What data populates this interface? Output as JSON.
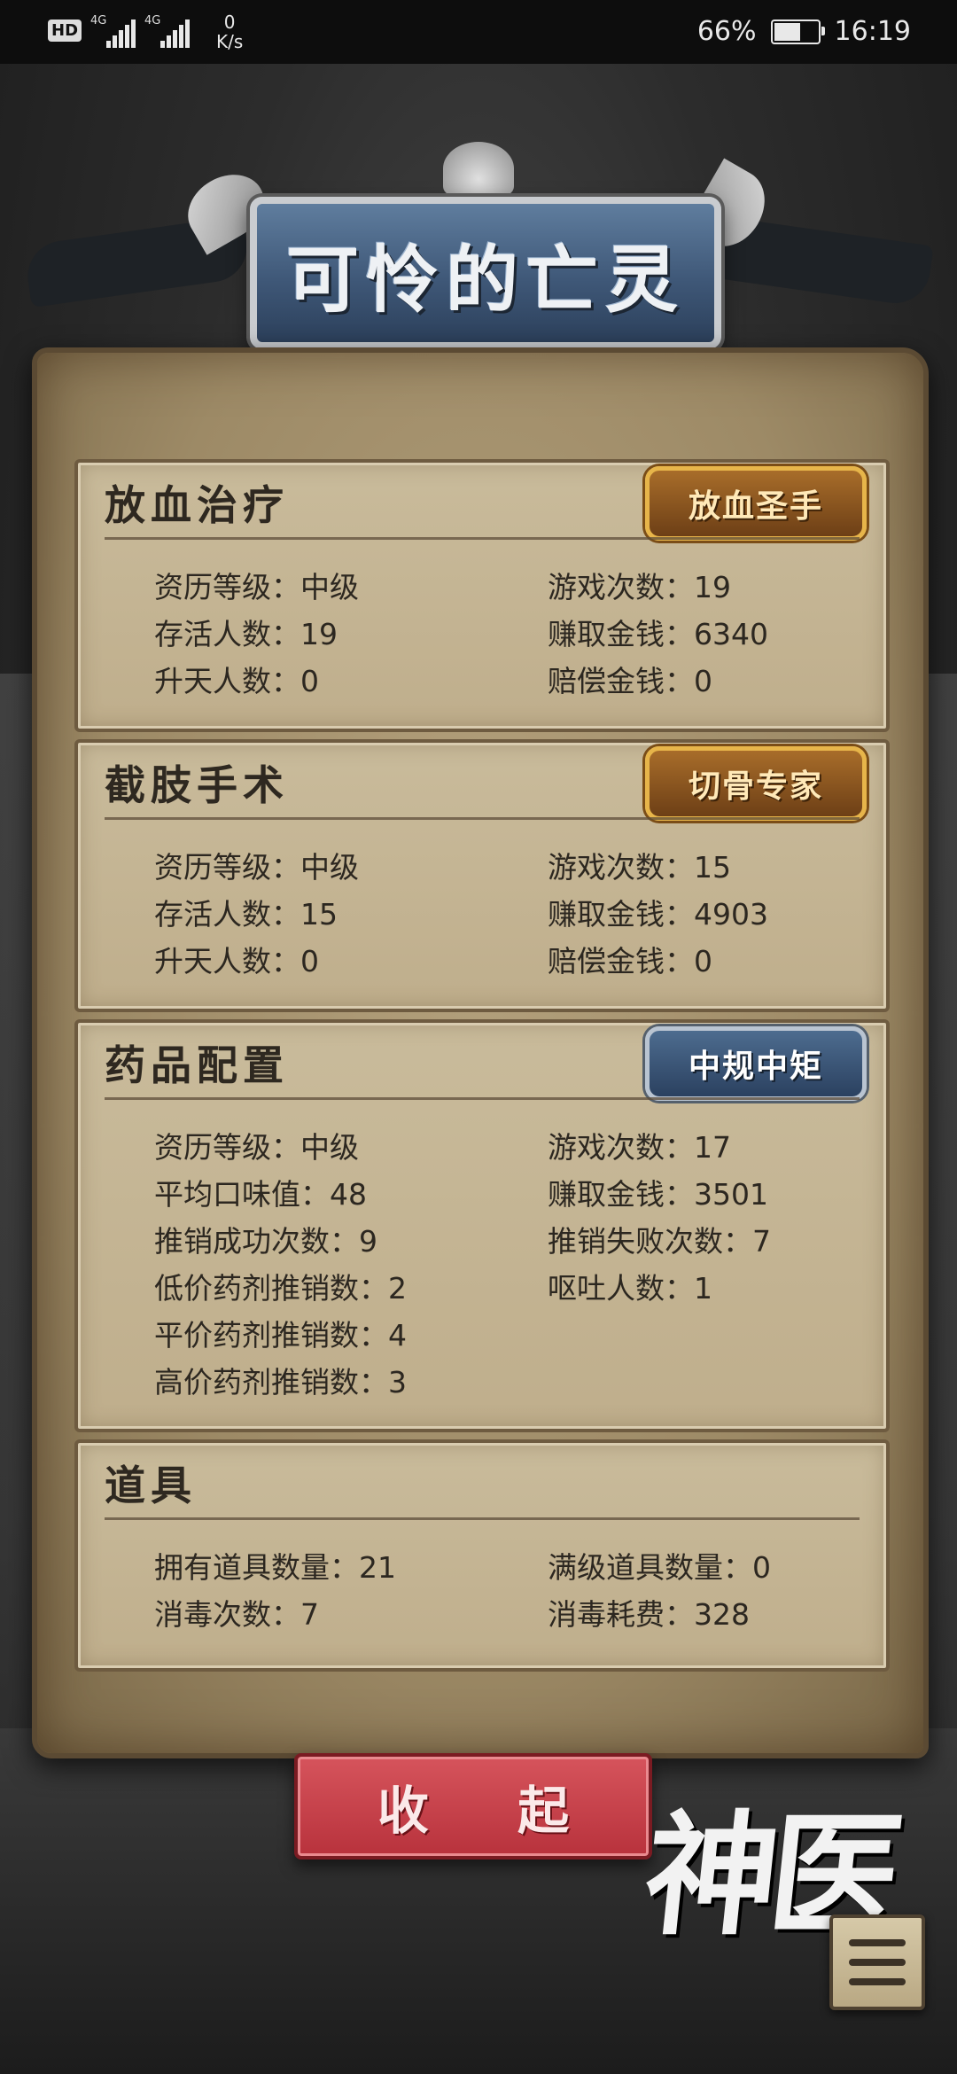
{
  "status_bar": {
    "hd": "HD",
    "signal1": "4G",
    "signal2": "4G",
    "net_speed_value": "0",
    "net_speed_unit": "K/s",
    "battery": "66%",
    "battery_level_pct": 66,
    "time": "16:19"
  },
  "title": "可怜的亡灵",
  "sections": [
    {
      "title": "放血治疗",
      "badge": "放血圣手",
      "stats_left": [
        "资历等级：中级",
        "存活人数：19",
        "升天人数：0"
      ],
      "stats_right": [
        "游戏次数：19",
        "赚取金钱：6340",
        "赔偿金钱：0"
      ]
    },
    {
      "title": "截肢手术",
      "badge": "切骨专家",
      "stats_left": [
        "资历等级：中级",
        "存活人数：15",
        "升天人数：0"
      ],
      "stats_right": [
        "游戏次数：15",
        "赚取金钱：4903",
        "赔偿金钱：0"
      ]
    },
    {
      "title": "药品配置",
      "badge": "中规中矩",
      "stats_left": [
        "资历等级：中级",
        "平均口味值：48",
        "推销成功次数：9",
        "低价药剂推销数：2",
        "平价药剂推销数：4",
        "高价药剂推销数：3"
      ],
      "stats_right": [
        "游戏次数：17",
        "赚取金钱：3501",
        "推销失败次数：7",
        "呕吐人数：1"
      ]
    },
    {
      "title": "道具",
      "stats_left": [
        "拥有道具数量：21",
        "消毒次数：7"
      ],
      "stats_right": [
        "满级道具数量：0",
        "消毒耗费：328"
      ]
    }
  ],
  "collapse_button": "收 起",
  "logo": "神医",
  "colors": {
    "parchment": "#b4a17d",
    "gold_badge": "#e7b54a",
    "blue_badge": "#4d6c8f",
    "collapse_button": "#d6545c"
  }
}
